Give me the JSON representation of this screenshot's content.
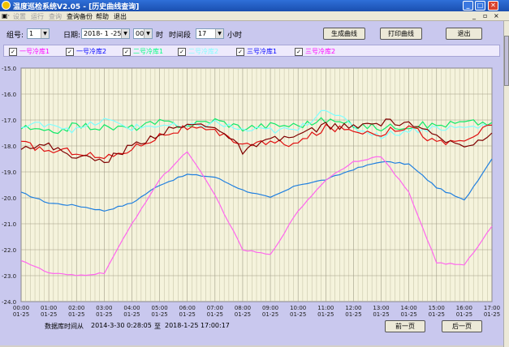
{
  "window": {
    "title": "温度巡检系统V2.05 - [历史曲线查询]"
  },
  "menu": {
    "items": [
      "设置",
      "运行",
      "查询",
      "查询备份",
      "帮助",
      "退出"
    ],
    "disabled": [
      true,
      true,
      true,
      false,
      false,
      false
    ]
  },
  "controls": {
    "group_label": "组号:",
    "group_value": "1",
    "date_label": "日期:",
    "date_value": "2018- 1 -25",
    "hour_value": "00",
    "hour_unit": "时",
    "span_label": "时间段",
    "span_value": "17",
    "span_unit": "小时",
    "btn_generate": "生成曲线",
    "btn_print": "打印曲线",
    "btn_exit": "退出"
  },
  "legend": [
    {
      "label": "一号冷库1",
      "color": "#ff00ff"
    },
    {
      "label": "一号冷库2",
      "color": "#0000ff"
    },
    {
      "label": "二号冷库1",
      "color": "#00ff80"
    },
    {
      "label": "二号冷库2",
      "color": "#80ffff"
    },
    {
      "label": "三号冷库1",
      "color": "#0000ff"
    },
    {
      "label": "三号冷库2",
      "color": "#ff00ff"
    }
  ],
  "chart_data": {
    "type": "line",
    "ylim": [
      -24.0,
      -15.0
    ],
    "yticks": [
      "-15.0",
      "-16.0",
      "-17.0",
      "-18.0",
      "-19.0",
      "-20.0",
      "-21.0",
      "-22.0",
      "-23.0",
      "-24.0"
    ],
    "x": [
      "00:00",
      "01:00",
      "02:00",
      "03:00",
      "04:00",
      "05:00",
      "06:00",
      "07:00",
      "08:00",
      "09:00",
      "10:00",
      "11:00",
      "12:00",
      "13:00",
      "14:00",
      "15:00",
      "16:00",
      "17:00"
    ],
    "x_date": "01-25",
    "series": [
      {
        "color": "#1f7fe0",
        "values": [
          -19.8,
          -20.2,
          -20.3,
          -20.5,
          -20.2,
          -19.5,
          -19.1,
          -19.2,
          -19.7,
          -20.0,
          -19.5,
          -19.3,
          -18.9,
          -18.6,
          -18.7,
          -19.6,
          -20.1,
          -18.5
        ]
      },
      {
        "color": "#ff66ee",
        "values": [
          -22.4,
          -22.9,
          -23.0,
          -22.9,
          -21.0,
          -19.3,
          -18.2,
          -19.9,
          -22.0,
          -22.2,
          -20.5,
          -19.3,
          -18.6,
          -18.4,
          -19.8,
          -22.5,
          -22.6,
          -21.1
        ]
      },
      {
        "color": "#10ea68",
        "values": [
          -17.3,
          -17.5,
          -17.2,
          -17.3,
          -17.3,
          -17.1,
          -17.2,
          -17.0,
          -17.3,
          -17.2,
          -17.2,
          -17.0,
          -17.2,
          -17.3,
          -17.2,
          -17.2,
          -17.1,
          -17.1
        ]
      },
      {
        "color": "#80ffff",
        "values": [
          -17.3,
          -17.1,
          -17.4,
          -17.0,
          -17.3,
          -17.2,
          -17.3,
          -17.1,
          -17.4,
          -17.4,
          -17.4,
          -16.5,
          -17.3,
          -17.6,
          -17.4,
          -17.3,
          -17.3,
          -17.2
        ]
      },
      {
        "color": "#e01010",
        "values": [
          -17.9,
          -18.2,
          -18.2,
          -18.5,
          -18.1,
          -17.6,
          -17.3,
          -17.5,
          -17.9,
          -17.9,
          -17.9,
          -17.3,
          -17.4,
          -17.5,
          -17.2,
          -17.9,
          -17.8,
          -17.2
        ]
      },
      {
        "color": "#800000",
        "values": [
          -18.0,
          -18.0,
          -18.4,
          -18.6,
          -18.0,
          -17.5,
          -17.2,
          -17.2,
          -18.2,
          -17.8,
          -17.6,
          -17.2,
          -17.3,
          -17.1,
          -17.1,
          -17.7,
          -18.0,
          -17.5
        ]
      }
    ]
  },
  "footer": {
    "range_label": "数据库时间从",
    "range_from": "2014-3-30 0:28:05",
    "range_to_label": "至",
    "range_to": "2018-1-25 17:00:17",
    "btn_prev": "前一页",
    "btn_next": "后一页"
  }
}
